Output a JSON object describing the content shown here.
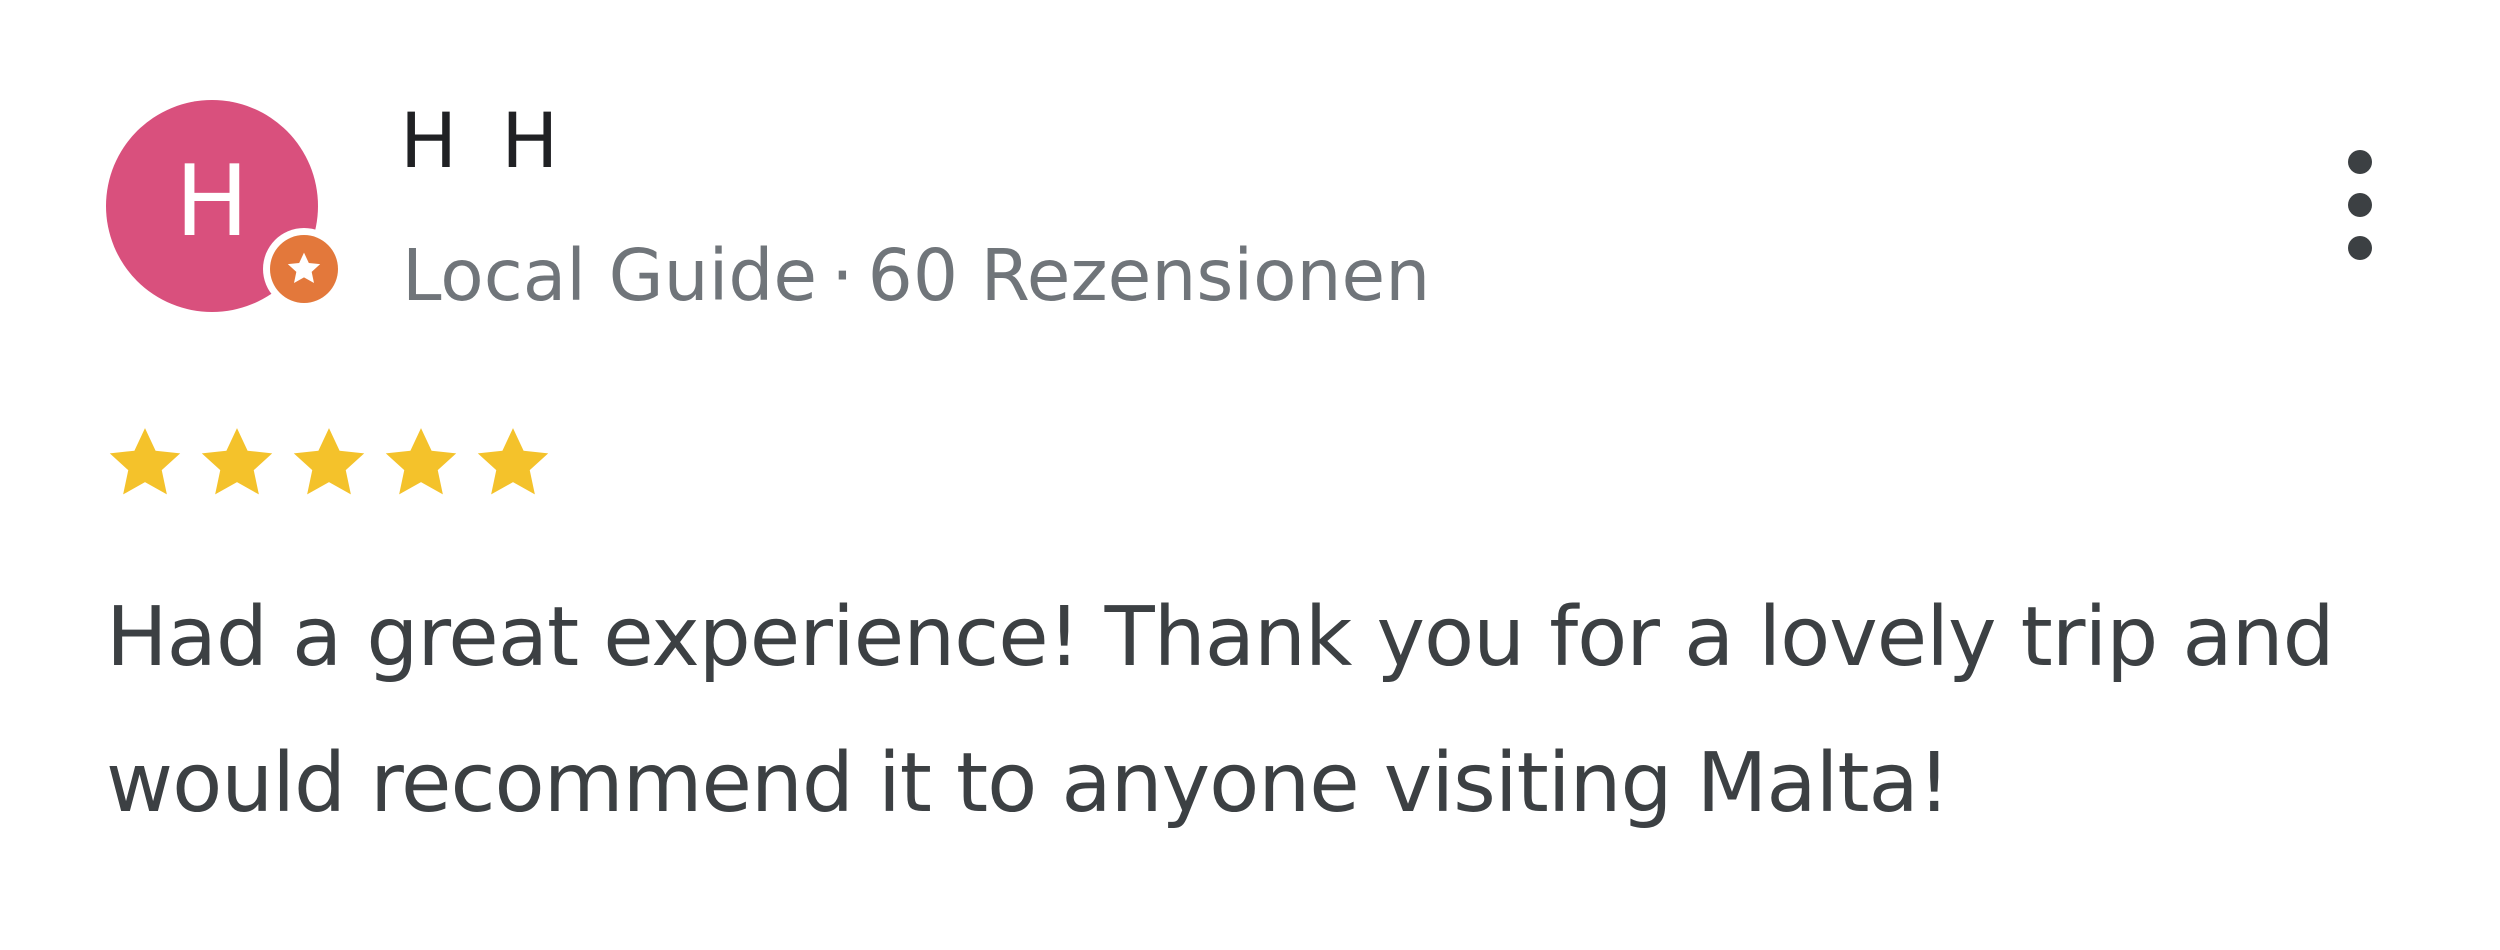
{
  "reviewer": {
    "initial": "H",
    "name": "H H",
    "badge": "Local Guide",
    "separator": "·",
    "reviews_count": "60 Rezensionen",
    "avatar_color": "#d9507d",
    "badge_color": "#e3783b"
  },
  "rating": {
    "value": 5,
    "max": 5,
    "star_color": "#f4c22b"
  },
  "review": {
    "line1": "Had a great experience! Thank you for a lovely trip and",
    "line2": "would recommend it to anyone visiting Malta!"
  },
  "icons": {
    "menu": "more-vertical-icon",
    "badge": "local-guide-star-icon",
    "star": "star-icon"
  }
}
